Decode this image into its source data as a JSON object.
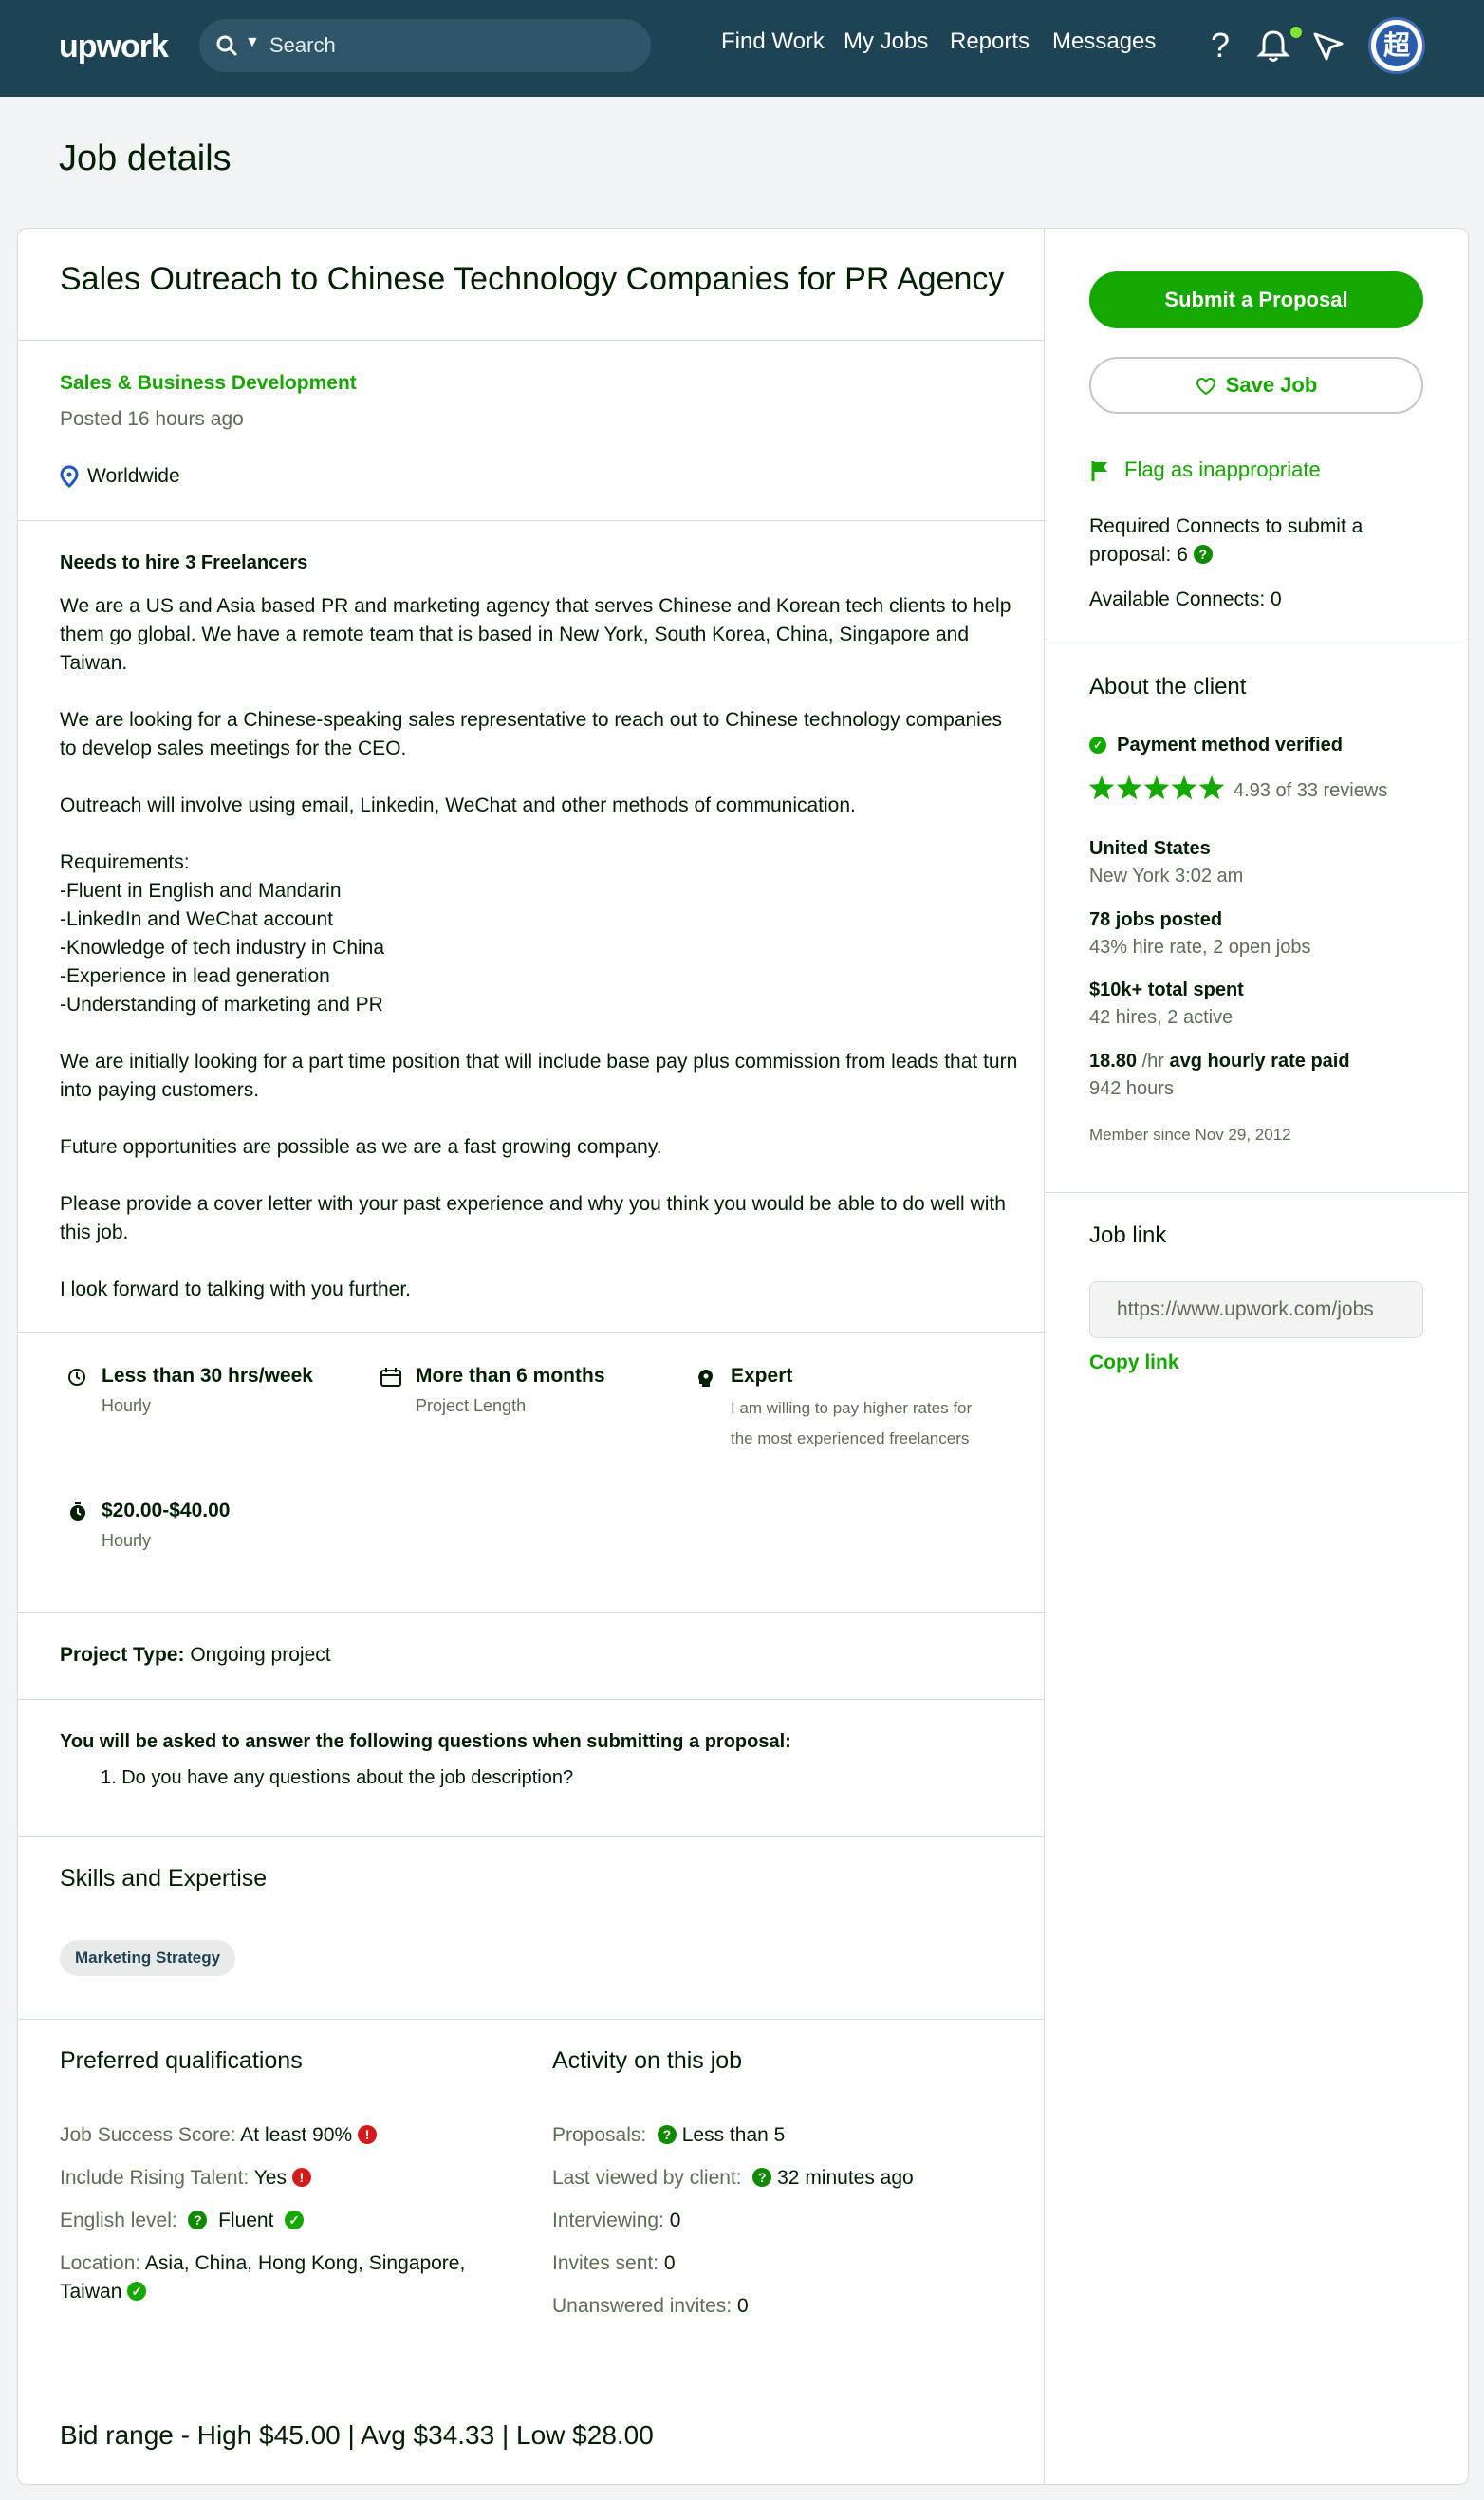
{
  "nav": {
    "logo": "upwork",
    "search_placeholder": "Search",
    "links": [
      "Find Work",
      "My Jobs",
      "Reports",
      "Messages"
    ],
    "avatar_glyph": "超"
  },
  "page": {
    "title": "Job details"
  },
  "job": {
    "title": "Sales Outreach to Chinese Technology Companies for PR Agency",
    "category": "Sales & Business Development",
    "posted": "Posted 16 hours ago",
    "location": "Worldwide",
    "needs": "Needs to hire 3 Freelancers",
    "description": [
      "We are a US and Asia based PR and marketing agency that serves Chinese and Korean tech clients to help them go global. We have a remote team that is based in New York, South Korea, China, Singapore and Taiwan.",
      "We are looking for a Chinese-speaking sales representative to reach out to Chinese technology companies to develop sales meetings for the CEO.",
      "Outreach will involve using email, Linkedin, WeChat and other methods of communication.",
      "Requirements:\n-Fluent in English and Mandarin\n-LinkedIn and WeChat account\n-Knowledge of tech industry in China\n-Experience in lead generation\n-Understanding of marketing and PR",
      "We are initially looking for a part time position that will include base pay plus commission from leads that turn into paying customers.",
      "Future opportunities are possible as we are a fast growing company.",
      "Please provide a cover letter with your past experience and why you think you would be able to do well with this job.",
      "I look forward to talking with you further."
    ],
    "features": {
      "hours": {
        "title": "Less than 30 hrs/week",
        "sub": "Hourly"
      },
      "length": {
        "title": "More than 6 months",
        "sub": "Project Length"
      },
      "level": {
        "title": "Expert",
        "sub": "I am willing to pay higher rates for the most experienced freelancers"
      },
      "rate": {
        "title": "$20.00-$40.00",
        "sub": "Hourly"
      }
    },
    "project_type_label": "Project Type:",
    "project_type_value": "Ongoing project",
    "questions_heading": "You will be asked to answer the following questions when submitting a proposal:",
    "questions": [
      "1. Do you have any questions about the job description?"
    ],
    "skills_heading": "Skills and Expertise",
    "skills": [
      "Marketing Strategy"
    ],
    "preferred": {
      "heading": "Preferred qualifications",
      "jss_label": "Job Success Score:",
      "jss_value": "At least 90%",
      "rising_label": "Include Rising Talent:",
      "rising_value": "Yes",
      "english_label": "English level:",
      "english_value": "Fluent",
      "location_label": "Location:",
      "location_value_1": "Asia, China, Hong Kong, Singapore,",
      "location_value_2": "Taiwan"
    },
    "activity": {
      "heading": "Activity on this job",
      "proposals_label": "Proposals:",
      "proposals_value": "Less than 5",
      "viewed_label": "Last viewed by client:",
      "viewed_value": "32 minutes ago",
      "interviewing_label": "Interviewing:",
      "interviewing_value": "0",
      "invites_label": "Invites sent:",
      "invites_value": "0",
      "unanswered_label": "Unanswered invites:",
      "unanswered_value": "0"
    },
    "bid_range": "Bid range - High $45.00 | Avg $34.33 | Low $28.00"
  },
  "sidebar": {
    "submit_label": "Submit a Proposal",
    "save_label": "Save Job",
    "flag_label": "Flag as inappropriate",
    "connects_required_1": "Required Connects to submit a",
    "connects_required_2": "proposal: 6",
    "connects_available": "Available Connects: 0",
    "client": {
      "heading": "About the client",
      "payment": "Payment method verified",
      "rating": 4.93,
      "rating_text": "4.93 of 33 reviews",
      "country": "United States",
      "local_time": "New York 3:02 am",
      "jobs_posted": "78 jobs posted",
      "hire_rate": "43% hire rate, 2 open jobs",
      "spent": "$10k+ total spent",
      "hires": "42 hires, 2 active",
      "avg_rate_value": "18.80",
      "avg_rate_unit": " /hr",
      "avg_rate_label": " avg hourly rate paid",
      "hours": "942 hours",
      "member_since": "Member since Nov 29, 2012"
    },
    "job_link_heading": "Job link",
    "job_link_value": "https://www.upwork.com/jobs",
    "copy_link": "Copy link"
  },
  "colors": {
    "brand_green": "#14a800",
    "nav_bg": "#1d4354",
    "error_red": "#d31b1b"
  }
}
